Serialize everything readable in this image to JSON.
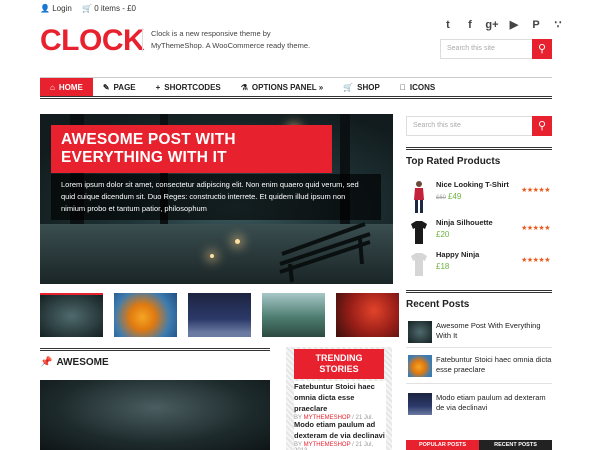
{
  "topbar": {
    "login": "Login",
    "cart": "0 items - £0"
  },
  "logo": "CLOCK",
  "tagline": "Clock is a new responsive theme by MyThemeShop. A WooCommerce ready theme.",
  "social": [
    "twitter-icon",
    "facebook-icon",
    "google-plus-icon",
    "youtube-icon",
    "pinterest-icon",
    "rss-icon"
  ],
  "search": {
    "placeholder": "Search this site"
  },
  "nav": [
    {
      "label": "HOME",
      "icon": "home-icon"
    },
    {
      "label": "PAGE",
      "icon": "page-icon"
    },
    {
      "label": "SHORTCODES",
      "icon": "plus-icon"
    },
    {
      "label": "OPTIONS PANEL »",
      "icon": "flask-icon"
    },
    {
      "label": "SHOP",
      "icon": "cart-icon"
    },
    {
      "label": "ICONS",
      "icon": "apple-icon"
    }
  ],
  "hero": {
    "title": "AWESOME POST WITH EVERYTHING WITH IT",
    "excerpt": "Lorem ipsum dolor sit amet, consectetur adipiscing elit. Non enim quaero quid verum, sed quid cuique dicendum sit. Duo Reges: constructio interrete. Et quidem illud ipsum non nimium probo et tantum patior, philosophum"
  },
  "section": {
    "title": "AWESOME"
  },
  "trending": {
    "title": "TRENDING STORIES",
    "posts": [
      {
        "title": "Fatebuntur Stoici haec omnia dicta esse praeclare",
        "by": "BY",
        "author": "MYTHEMESHOP",
        "date": "/ 21 Jul, 2013"
      },
      {
        "title": "Modo etiam paulum ad dexteram de via declinavi",
        "by": "BY",
        "author": "MYTHEMESHOP",
        "date": "/ 21 Jul, 2013"
      }
    ]
  },
  "sidebar": {
    "top_rated_title": "Top Rated Products",
    "products": [
      {
        "name": "Nice Looking T-Shirt",
        "old_price": "£60",
        "price": "£49",
        "stars": "★★★★★"
      },
      {
        "name": "Ninja Silhouette",
        "old_price": "",
        "price": "£20",
        "stars": "★★★★★"
      },
      {
        "name": "Happy Ninja",
        "old_price": "",
        "price": "£18",
        "stars": "★★★★★"
      }
    ],
    "recent_title": "Recent Posts",
    "recent_posts": [
      "Awesome Post With Everything With It",
      "Fatebuntur Stoici haec omnia dicta esse praeclare",
      "Modo etiam paulum ad dexteram de via declinavi"
    ],
    "tabs": [
      "POPULAR POSTS",
      "RECENT POSTS"
    ]
  },
  "colors": {
    "accent": "#e8212f",
    "price": "#6cb33f",
    "stars": "#e85a1d"
  }
}
